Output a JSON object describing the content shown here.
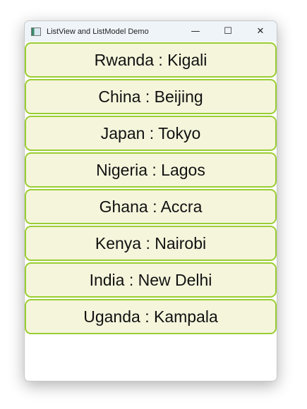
{
  "window": {
    "title": "ListView and ListModel Demo"
  },
  "items": [
    {
      "label": "Rwanda : Kigali"
    },
    {
      "label": "China : Beijing"
    },
    {
      "label": "Japan : Tokyo"
    },
    {
      "label": "Nigeria : Lagos"
    },
    {
      "label": "Ghana : Accra"
    },
    {
      "label": "Kenya : Nairobi"
    },
    {
      "label": "India : New Delhi"
    },
    {
      "label": "Uganda : Kampala"
    }
  ]
}
